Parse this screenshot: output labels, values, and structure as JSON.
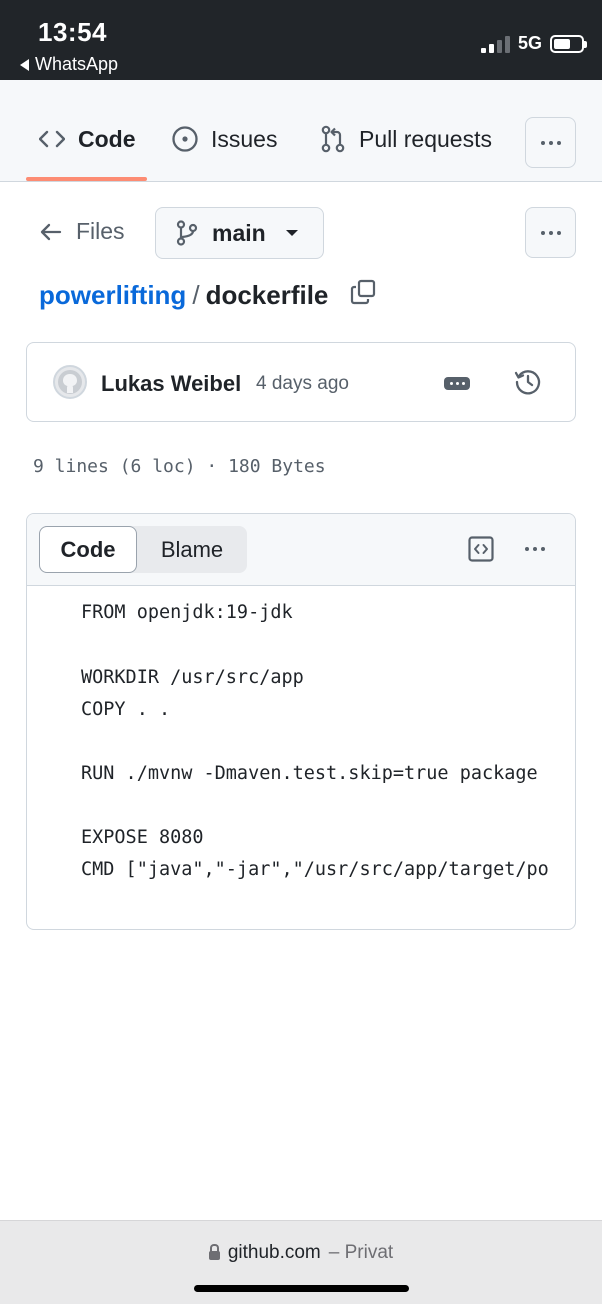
{
  "status_bar": {
    "time": "13:54",
    "back_app": "WhatsApp",
    "network": "5G"
  },
  "repo_nav": {
    "tabs": [
      {
        "label": "Code",
        "icon": "code-icon",
        "active": true
      },
      {
        "label": "Issues",
        "icon": "issue-opened-icon",
        "active": false
      },
      {
        "label": "Pull requests",
        "icon": "git-pull-request-icon",
        "active": false
      }
    ],
    "active_underline_color": "#fd8c73"
  },
  "file_toolbar": {
    "files_label": "Files",
    "branch": "main"
  },
  "breadcrumb": {
    "repo": "powerlifting",
    "separator": "/",
    "file": "dockerfile",
    "repo_link_color": "#0969da"
  },
  "commit": {
    "author": "Lukas Weibel",
    "time": "4 days ago"
  },
  "file_meta": "9 lines (6 loc) · 180 Bytes",
  "code_view": {
    "tabs": [
      "Code",
      "Blame"
    ],
    "selected_tab": "Code",
    "lines": [
      "FROM openjdk:19-jdk",
      "",
      "WORKDIR /usr/src/app",
      "COPY . .",
      "",
      "RUN ./mvnw -Dmaven.test.skip=true package",
      "",
      "EXPOSE 8080",
      "CMD [\"java\",\"-jar\",\"/usr/src/app/target/po"
    ]
  },
  "browser_bar": {
    "domain": "github.com",
    "privacy": "– Privat"
  }
}
